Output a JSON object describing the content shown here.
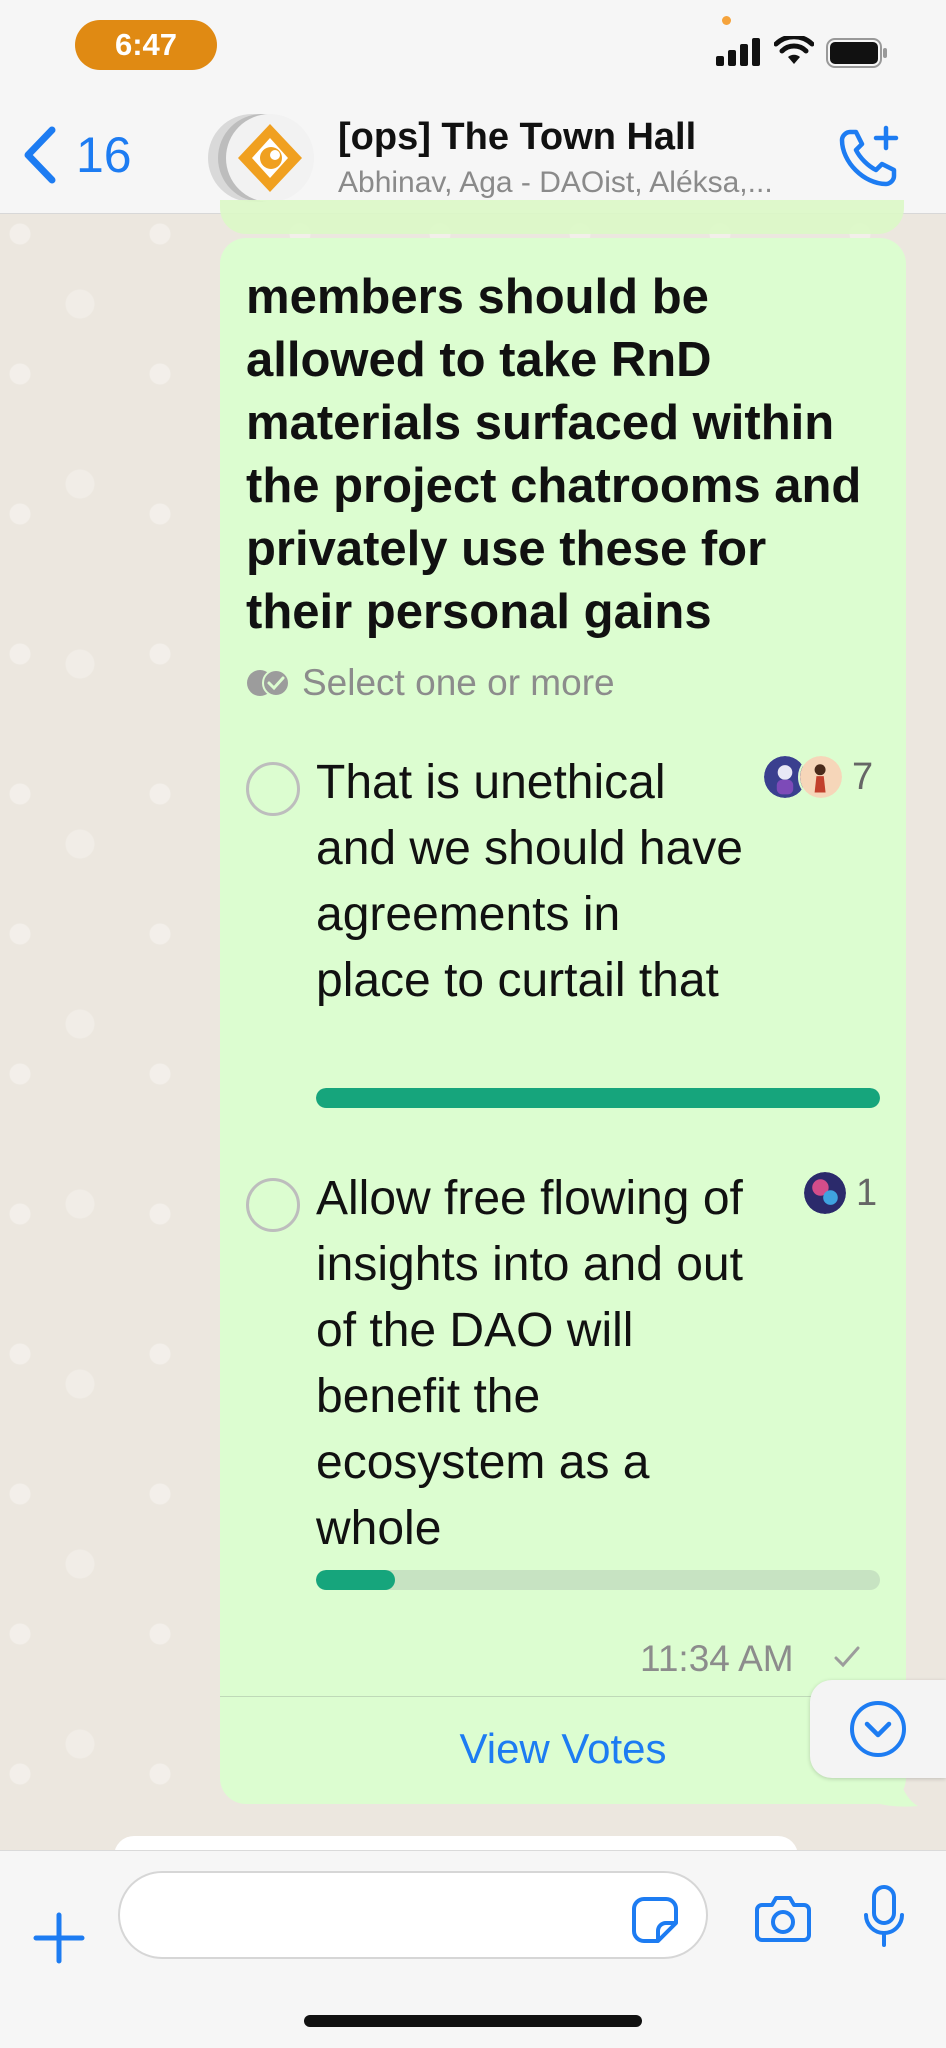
{
  "status_bar": {
    "time": "6:47"
  },
  "header": {
    "back_count": "16",
    "title": "[ops] The Town Hall",
    "subtitle": "Abhinav, Aga - DAOist, Aléksa,..."
  },
  "poll": {
    "question": "members should be allowed to take RnD materials surfaced within the project chatrooms and privately use these for their personal gains",
    "hint": "Select one or more",
    "options": [
      {
        "text": "That is unethical and we should have agreements in place to curtail that",
        "votes": "7",
        "share": 1.0
      },
      {
        "text": "Allow free flowing of insights into and out of the DAO will benefit the ecosystem as a whole",
        "votes": "1",
        "share": 0.14
      }
    ],
    "time": "11:34 AM",
    "view_votes": "View Votes"
  },
  "colors": {
    "accent": "#1d7cf2",
    "bubble": "#dcfdd0",
    "vote_bar": "#16a57c",
    "time_pill": "#e08a13"
  },
  "icons": {
    "back": "chevron-left-icon",
    "call": "phone-plus-icon",
    "hint": "double-check-icon",
    "scroll": "chevron-down-circle-icon",
    "plus": "plus-icon",
    "sticker": "sticker-icon",
    "camera": "camera-icon",
    "mic": "microphone-icon"
  }
}
